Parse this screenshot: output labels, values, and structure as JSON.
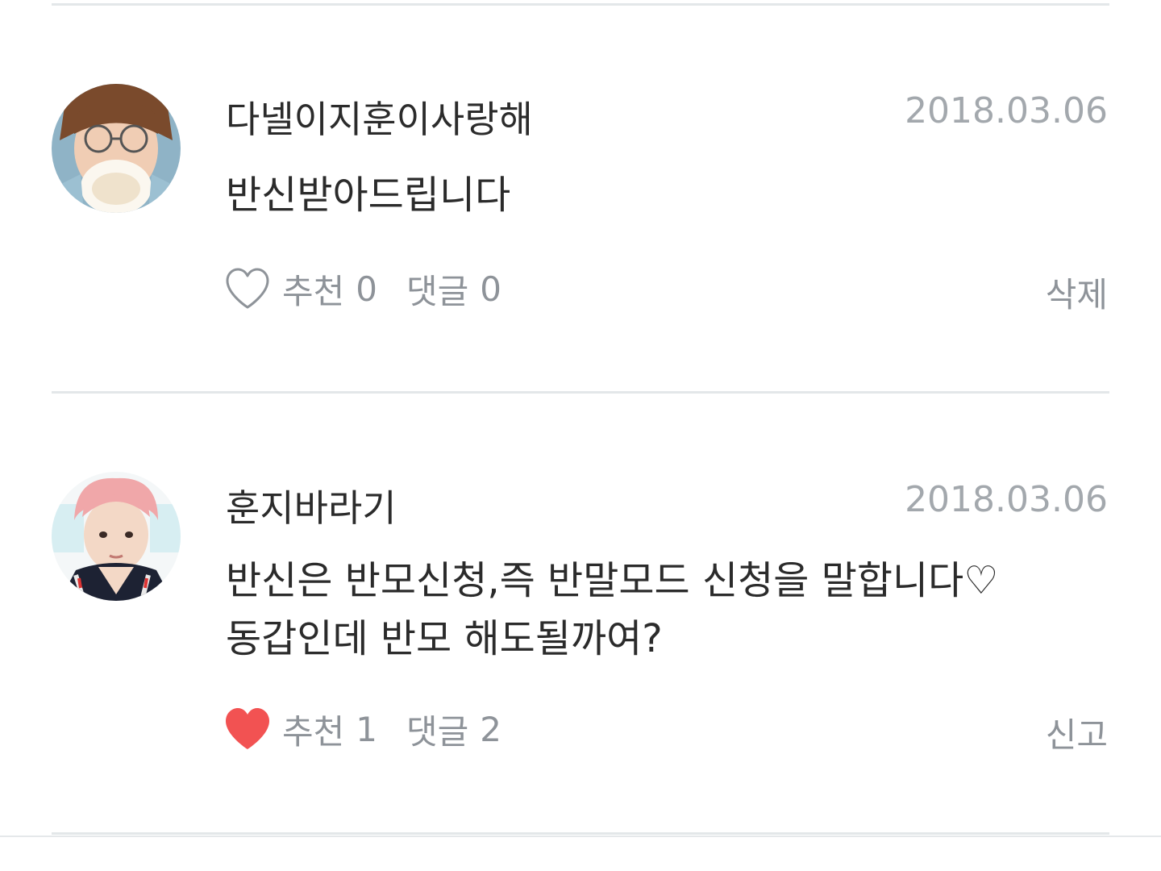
{
  "comments": [
    {
      "username": "다넬이지훈이사랑해",
      "date": "2018.03.06",
      "text_lines": [
        "반신받아드립니다"
      ],
      "like_label": "추천",
      "like_count": "0",
      "liked": false,
      "reply_label": "댓글",
      "reply_count": "0",
      "right_action": "삭제"
    },
    {
      "username": "훈지바라기",
      "date": "2018.03.06",
      "text_lines": [
        "반신은 반모신청,즉 반말모드 신청을 말합니다♡",
        "동갑인데 반모 해도될까여?"
      ],
      "like_label": "추천",
      "like_count": "1",
      "liked": true,
      "reply_label": "댓글",
      "reply_count": "2",
      "right_action": "신고"
    }
  ],
  "colors": {
    "heart_active": "#f25252",
    "heart_inactive": "#8e9399",
    "meta_text": "#8e9399",
    "date_text": "#a3a8ad"
  },
  "icons": {
    "like_outline": "heart-outline-icon",
    "like_filled": "heart-filled-icon"
  }
}
